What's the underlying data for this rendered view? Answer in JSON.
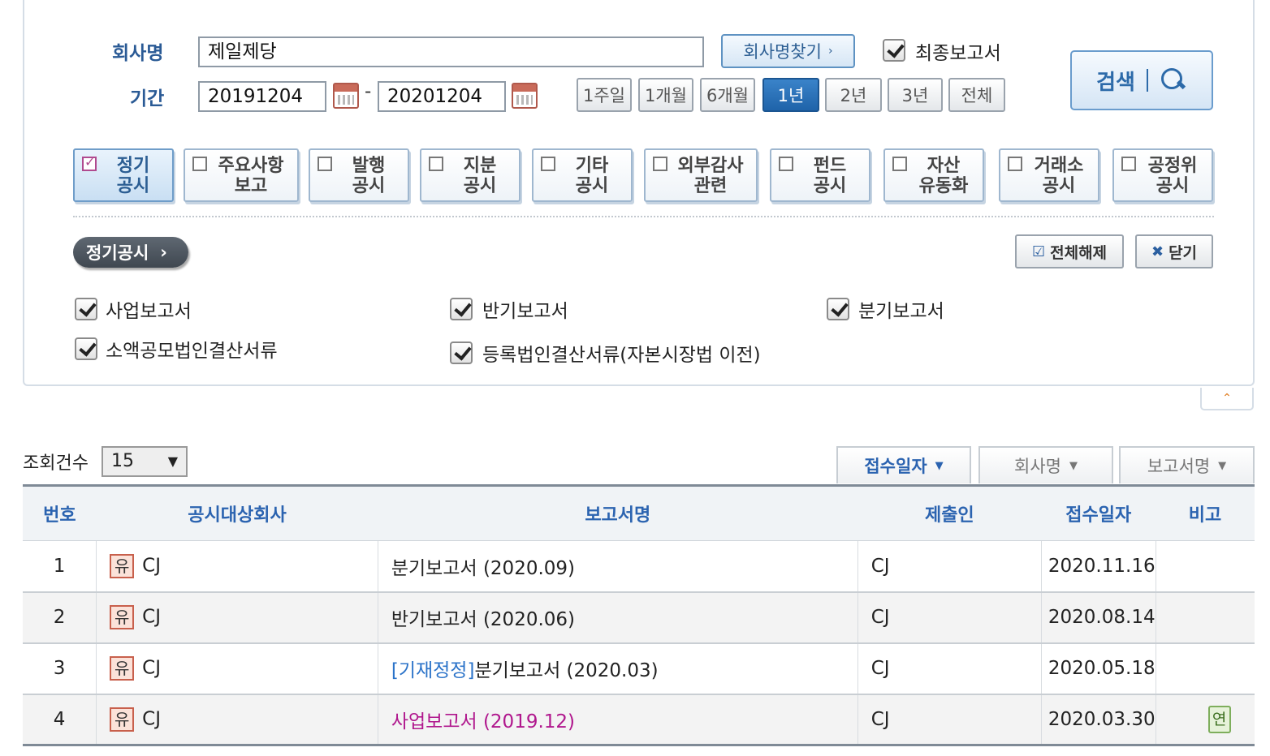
{
  "search": {
    "company_label": "회사명",
    "company_value": "제일제당",
    "find_company_button": "회사명찾기",
    "final_report_label": "최종보고서",
    "final_report_checked": true,
    "period_label": "기간",
    "date_from": "20191204",
    "date_separator": "-",
    "date_to": "20201204",
    "period_buttons": [
      "1주일",
      "1개월",
      "6개월",
      "1년",
      "2년",
      "3년",
      "전체"
    ],
    "period_active": "1년",
    "search_button": "검색"
  },
  "categories": [
    {
      "label": "정기\n공시",
      "active": true
    },
    {
      "label": "주요사항\n보고",
      "active": false
    },
    {
      "label": "발행\n공시",
      "active": false
    },
    {
      "label": "지분\n공시",
      "active": false
    },
    {
      "label": "기타\n공시",
      "active": false
    },
    {
      "label": "외부감사\n관련",
      "active": false
    },
    {
      "label": "펀드\n공시",
      "active": false
    },
    {
      "label": "자산\n유동화",
      "active": false
    },
    {
      "label": "거래소\n공시",
      "active": false
    },
    {
      "label": "공정위\n공시",
      "active": false
    }
  ],
  "subpanel": {
    "title": "정기공시",
    "deselect_all": "전체해제",
    "close": "닫기",
    "options": [
      {
        "label": "사업보고서",
        "checked": true
      },
      {
        "label": "반기보고서",
        "checked": true
      },
      {
        "label": "분기보고서",
        "checked": true
      },
      {
        "label": "소액공모법인결산서류",
        "checked": true
      },
      {
        "label": "등록법인결산서류(자본시장법 이전)",
        "checked": true
      }
    ]
  },
  "results": {
    "count_label": "조회건수",
    "count_value": "15",
    "sort_buttons": [
      "접수일자",
      "회사명",
      "보고서명"
    ],
    "sort_active": "접수일자",
    "columns": [
      "번호",
      "공시대상회사",
      "보고서명",
      "제출인",
      "접수일자",
      "비고"
    ],
    "rows": [
      {
        "no": "1",
        "market_mark": "유",
        "company": "CJ",
        "report_tag": "",
        "report": "분기보고서 (2020.09)",
        "submitter": "CJ",
        "date": "2020.11.16",
        "note": ""
      },
      {
        "no": "2",
        "market_mark": "유",
        "company": "CJ",
        "report_tag": "",
        "report": "반기보고서 (2020.06)",
        "submitter": "CJ",
        "date": "2020.08.14",
        "note": ""
      },
      {
        "no": "3",
        "market_mark": "유",
        "company": "CJ",
        "report_tag": "[기재정정]",
        "report": "분기보고서 (2020.03)",
        "submitter": "CJ",
        "date": "2020.05.18",
        "note": ""
      },
      {
        "no": "4",
        "market_mark": "유",
        "company": "CJ",
        "report_tag": "",
        "report": "사업보고서 (2019.12)",
        "submitter": "CJ",
        "date": "2020.03.30",
        "note": "연"
      }
    ]
  },
  "colors": {
    "accent_blue": "#2b63b0",
    "active_button": "#2a74bd",
    "magenta_link": "#b0178d",
    "market_mark_bg": "#fbe2d9",
    "note_badge_bg": "#e6f2d9"
  }
}
